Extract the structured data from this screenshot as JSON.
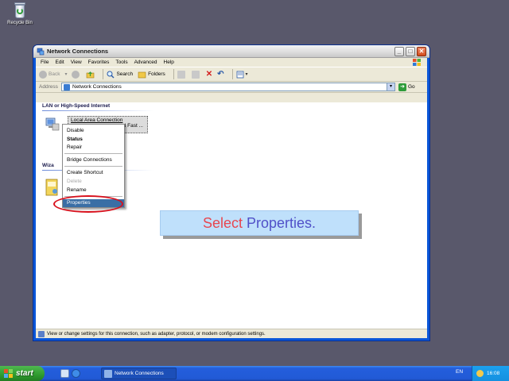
{
  "desktop": {
    "recycle_bin_label": "Recycle Bin"
  },
  "window": {
    "title": "Network Connections",
    "controls": {
      "minimize": "_",
      "maximize": "□",
      "close": "✕"
    },
    "menu": [
      "File",
      "Edit",
      "View",
      "Favorites",
      "Tools",
      "Advanced",
      "Help"
    ],
    "toolbar": {
      "back": "Back",
      "search": "Search",
      "folders": "Folders"
    },
    "address": {
      "label": "Address",
      "value": "Network Connections",
      "go": "Go"
    },
    "groups": {
      "lan": "LAN or High-Speed Internet",
      "wizard": "Wiza"
    },
    "connection": {
      "line1": "Local Area Connection",
      "line2": "d Fast ..."
    },
    "wizard_item_fragment": "d",
    "status_text": "View or change settings for this connection, such as adapter, protocol, or modem configuration settings."
  },
  "context_menu": {
    "items": [
      {
        "label": "Disable"
      },
      {
        "label": "Status"
      },
      {
        "label": "Repair"
      },
      {
        "label": "Bridge Connections"
      },
      {
        "label": "Create Shortcut"
      },
      {
        "label": "Delete"
      },
      {
        "label": "Rename"
      },
      {
        "label": "Properties"
      }
    ]
  },
  "callout": {
    "word1": "Select",
    "word2": "Properties."
  },
  "taskbar": {
    "start_label": "start",
    "task_title": "Network Connections",
    "language": "EN",
    "clock": "16:08"
  },
  "colors": {
    "highlight_ring": "#d8101c",
    "callout_bg": "#bfe0fb",
    "callout_word1": "#e8464f",
    "callout_word2": "#5050c8",
    "taskbar_blue": "#245edc",
    "start_green": "#2e9b2e"
  }
}
